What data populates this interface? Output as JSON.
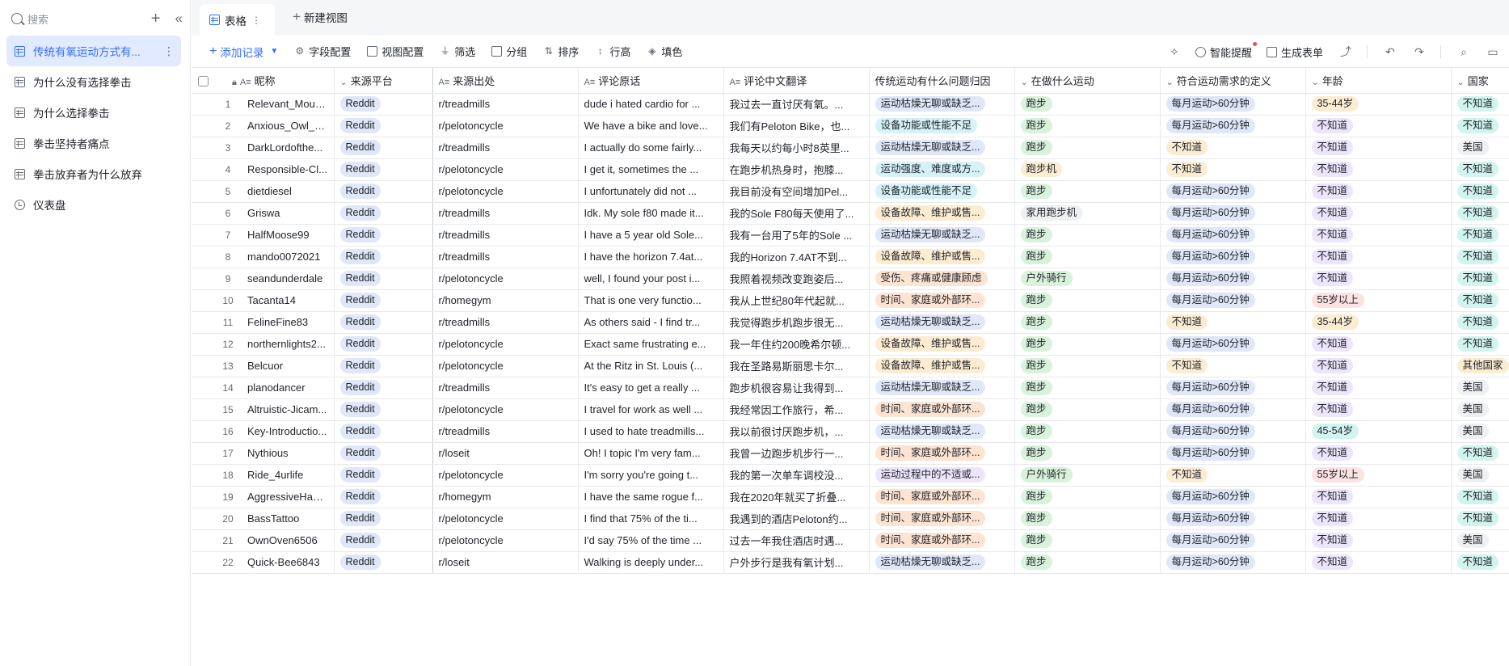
{
  "sidebar": {
    "search_placeholder": "搜索",
    "items": [
      {
        "label": "传统有氧运动方式有...",
        "icon": "table-icon",
        "active": true
      },
      {
        "label": "为什么没有选择拳击",
        "icon": "table-icon"
      },
      {
        "label": "为什么选择拳击",
        "icon": "table-icon"
      },
      {
        "label": "拳击坚持者痛点",
        "icon": "table-icon"
      },
      {
        "label": "拳击放弃者为什么放弃",
        "icon": "table-icon"
      },
      {
        "label": "仪表盘",
        "icon": "dashboard-icon"
      }
    ]
  },
  "tabs": {
    "active_label": "表格",
    "new_view_label": "新建视图"
  },
  "toolbar": {
    "add_record": "添加记录",
    "field_config": "字段配置",
    "view_config": "视图配置",
    "filter": "筛选",
    "group": "分组",
    "sort": "排序",
    "row_height": "行高",
    "fill_color": "填色",
    "smart_reminder": "智能提醒",
    "generate_form": "生成表单"
  },
  "columns": {
    "nickname": "昵称",
    "platform": "来源平台",
    "source": "来源出处",
    "original": "评论原话",
    "translation": "评论中文翻译",
    "problem": "传统运动有什么问题归因",
    "activity": "在做什么运动",
    "definition": "符合运动需求的定义",
    "age": "年龄",
    "country": "国家"
  },
  "rows": [
    {
      "n": "1",
      "nick": "Relevant_Moun...",
      "plat": "Reddit",
      "src": "r/treadmills",
      "orig": "dude i hated cardio for ...",
      "tr": "我过去一直讨厌有氧。...",
      "prob": "运动枯燥无聊或缺乏...",
      "act": "跑步",
      "def": "每月运动>60分钟",
      "age": "35-44岁",
      "ctry": "不知道"
    },
    {
      "n": "2",
      "nick": "Anxious_Owl_6...",
      "plat": "Reddit",
      "src": "r/pelotoncycle",
      "orig": "We have a bike and love...",
      "tr": "我们有Peloton Bike，也...",
      "prob": "设备功能或性能不足",
      "act": "跑步",
      "def": "每月运动>60分钟",
      "age": "不知道",
      "ctry": "不知道"
    },
    {
      "n": "3",
      "nick": "DarkLordofthe...",
      "plat": "Reddit",
      "src": "r/treadmills",
      "orig": "I actually do some fairly...",
      "tr": "我每天以约每小时8英里...",
      "prob": "运动枯燥无聊或缺乏...",
      "act": "跑步",
      "def": "不知道",
      "age": "不知道",
      "ctry": "美国"
    },
    {
      "n": "4",
      "nick": "Responsible-Cl...",
      "plat": "Reddit",
      "src": "r/pelotoncycle",
      "orig": "I get it, sometimes the ...",
      "tr": "在跑步机热身时，抱膝...",
      "prob": "运动强度、难度或方...",
      "act": "跑步机",
      "def": "不知道",
      "age": "不知道",
      "ctry": "不知道"
    },
    {
      "n": "5",
      "nick": "dietdiesel",
      "plat": "Reddit",
      "src": "r/pelotoncycle",
      "orig": "I unfortunately did not ...",
      "tr": "我目前没有空间增加Pel...",
      "prob": "设备功能或性能不足",
      "act": "跑步",
      "def": "每月运动>60分钟",
      "age": "不知道",
      "ctry": "不知道"
    },
    {
      "n": "6",
      "nick": "Griswa",
      "plat": "Reddit",
      "src": "r/treadmills",
      "orig": "Idk. My sole f80 made it...",
      "tr": "我的Sole F80每天使用了...",
      "prob": "设备故障、维护或售...",
      "act": "家用跑步机",
      "def": "每月运动>60分钟",
      "age": "不知道",
      "ctry": "不知道"
    },
    {
      "n": "7",
      "nick": "HalfMoose99",
      "plat": "Reddit",
      "src": "r/treadmills",
      "orig": "I have a 5 year old Sole...",
      "tr": "我有一台用了5年的Sole ...",
      "prob": "运动枯燥无聊或缺乏...",
      "act": "跑步",
      "def": "每月运动>60分钟",
      "age": "不知道",
      "ctry": "不知道"
    },
    {
      "n": "8",
      "nick": "mando0072021",
      "plat": "Reddit",
      "src": "r/treadmills",
      "orig": "I have the horizon 7.4at...",
      "tr": "我的Horizon 7.4AT不到...",
      "prob": "设备故障、维护或售...",
      "act": "跑步",
      "def": "每月运动>60分钟",
      "age": "不知道",
      "ctry": "不知道"
    },
    {
      "n": "9",
      "nick": "seandunderdale",
      "plat": "Reddit",
      "src": "r/pelotoncycle",
      "orig": "well, I found your post i...",
      "tr": "我照着视频改变跑姿后...",
      "prob": "受伤、疼痛或健康顾虑",
      "act": "户外骑行",
      "def": "每月运动>60分钟",
      "age": "不知道",
      "ctry": "不知道"
    },
    {
      "n": "10",
      "nick": "Tacanta14",
      "plat": "Reddit",
      "src": "r/homegym",
      "orig": "That is one very functio...",
      "tr": "我从上世纪80年代起就...",
      "prob": "时间、家庭或外部环...",
      "act": "跑步",
      "def": "每月运动>60分钟",
      "age": "55岁以上",
      "ctry": "不知道"
    },
    {
      "n": "11",
      "nick": "FelineFine83",
      "plat": "Reddit",
      "src": "r/treadmills",
      "orig": "As others said - I find tr...",
      "tr": "我觉得跑步机跑步很无...",
      "prob": "运动枯燥无聊或缺乏...",
      "act": "跑步",
      "def": "不知道",
      "age": "35-44岁",
      "ctry": "不知道"
    },
    {
      "n": "12",
      "nick": "northernlights2...",
      "plat": "Reddit",
      "src": "r/pelotoncycle",
      "orig": "Exact same frustrating e...",
      "tr": "我一年住约200晚希尔顿...",
      "prob": "设备故障、维护或售...",
      "act": "跑步",
      "def": "每月运动>60分钟",
      "age": "不知道",
      "ctry": "不知道"
    },
    {
      "n": "13",
      "nick": "Belcuor",
      "plat": "Reddit",
      "src": "r/pelotoncycle",
      "orig": "At the Ritz in St. Louis (...",
      "tr": "我在圣路易斯丽思卡尔...",
      "prob": "设备故障、维护或售...",
      "act": "跑步",
      "def": "不知道",
      "age": "不知道",
      "ctry": "其他国家"
    },
    {
      "n": "14",
      "nick": "planodancer",
      "plat": "Reddit",
      "src": "r/treadmills",
      "orig": "It's easy to get a really ...",
      "tr": "跑步机很容易让我得到...",
      "prob": "运动枯燥无聊或缺乏...",
      "act": "跑步",
      "def": "每月运动>60分钟",
      "age": "不知道",
      "ctry": "美国"
    },
    {
      "n": "15",
      "nick": "Altruistic-Jicam...",
      "plat": "Reddit",
      "src": "r/pelotoncycle",
      "orig": "I travel for work as well ...",
      "tr": "我经常因工作旅行，希...",
      "prob": "时间、家庭或外部环...",
      "act": "跑步",
      "def": "每月运动>60分钟",
      "age": "不知道",
      "ctry": "美国"
    },
    {
      "n": "16",
      "nick": "Key-Introductio...",
      "plat": "Reddit",
      "src": "r/treadmills",
      "orig": "I used to hate treadmills...",
      "tr": "我以前很讨厌跑步机，...",
      "prob": "运动枯燥无聊或缺乏...",
      "act": "跑步",
      "def": "每月运动>60分钟",
      "age": "45-54岁",
      "ctry": "美国"
    },
    {
      "n": "17",
      "nick": "Nythious",
      "plat": "Reddit",
      "src": "r/loseit",
      "orig": "Oh! I topic I'm very fam...",
      "tr": "我曾一边跑步机步行一...",
      "prob": "时间、家庭或外部环...",
      "act": "跑步",
      "def": "每月运动>60分钟",
      "age": "不知道",
      "ctry": "不知道"
    },
    {
      "n": "18",
      "nick": "Ride_4urlife",
      "plat": "Reddit",
      "src": "r/pelotoncycle",
      "orig": "I'm sorry you're going t...",
      "tr": "我的第一次单车调校没...",
      "prob": "运动过程中的不适或...",
      "act": "户外骑行",
      "def": "不知道",
      "age": "55岁以上",
      "ctry": "美国"
    },
    {
      "n": "19",
      "nick": "AggressiveHabi...",
      "plat": "Reddit",
      "src": "r/homegym",
      "orig": "I have the same rogue f...",
      "tr": "我在2020年就买了折叠...",
      "prob": "时间、家庭或外部环...",
      "act": "跑步",
      "def": "每月运动>60分钟",
      "age": "不知道",
      "ctry": "不知道"
    },
    {
      "n": "20",
      "nick": "BassTattoo",
      "plat": "Reddit",
      "src": "r/pelotoncycle",
      "orig": "I find that 75% of the ti...",
      "tr": "我遇到的酒店Peloton约...",
      "prob": "时间、家庭或外部环...",
      "act": "跑步",
      "def": "每月运动>60分钟",
      "age": "不知道",
      "ctry": "不知道"
    },
    {
      "n": "21",
      "nick": "OwnOven6506",
      "plat": "Reddit",
      "src": "r/pelotoncycle",
      "orig": "I'd say 75% of the time ...",
      "tr": "过去一年我住酒店时遇...",
      "prob": "时间、家庭或外部环...",
      "act": "跑步",
      "def": "每月运动>60分钟",
      "age": "不知道",
      "ctry": "美国"
    },
    {
      "n": "22",
      "nick": "Quick-Bee6843",
      "plat": "Reddit",
      "src": "r/loseit",
      "orig": "Walking is deeply under...",
      "tr": "户外步行是我有氧计划...",
      "prob": "运动枯燥无聊或缺乏...",
      "act": "跑步",
      "def": "每月运动>60分钟",
      "age": "不知道",
      "ctry": "不知道"
    }
  ],
  "tag_colors": {
    "运动枯燥无聊或缺乏...": "blue",
    "设备功能或性能不足": "cyan",
    "运动强度、难度或方...": "cyan",
    "设备故障、维护或售...": "yellow",
    "受伤、疼痛或健康顾虑": "orange",
    "时间、家庭或外部环...": "orange",
    "运动过程中的不适或...": "purple",
    "跑步": "green",
    "跑步机": "yellow",
    "家用跑步机": "gray",
    "户外骑行": "green",
    "每月运动>60分钟": "blue",
    "不知道": "yellow",
    "35-44岁": "yellow",
    "55岁以上": "red",
    "45-54岁": "teal",
    "美国": "gray",
    "其他国家": "yellow"
  }
}
